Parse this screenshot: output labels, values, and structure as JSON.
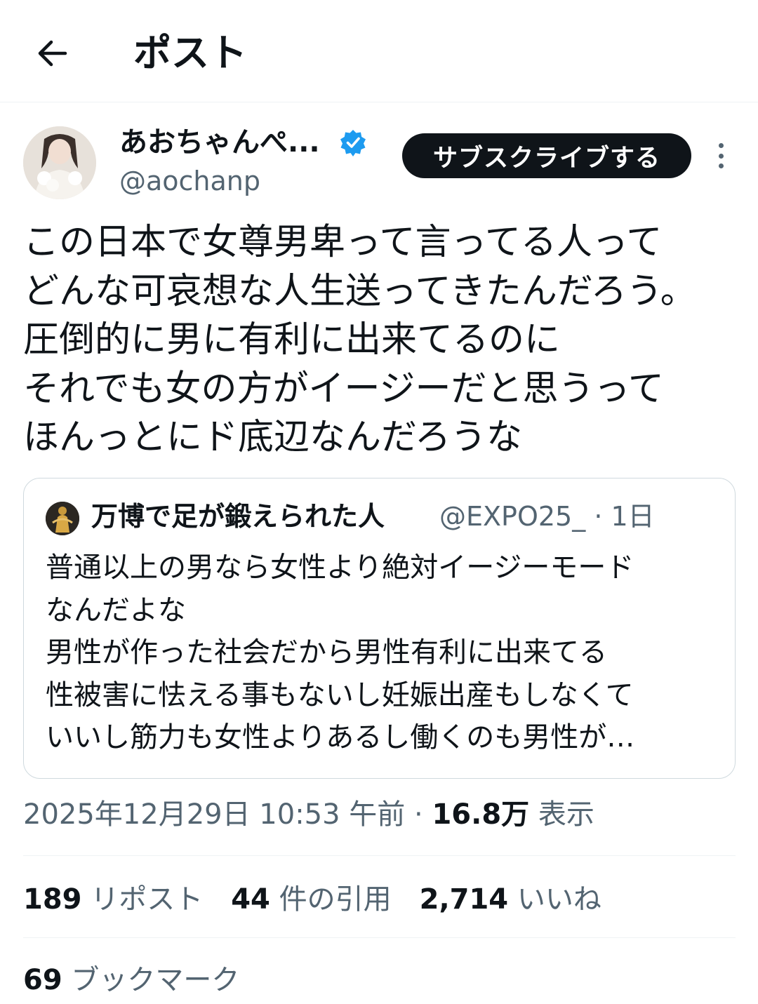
{
  "header": {
    "title": "ポスト",
    "back_icon": "arrow-left-icon"
  },
  "author": {
    "name": "あおちゃんぺ...",
    "handle": "@aochanp",
    "verified_color": "#1d9bf0",
    "subscribe_label": "サブスクライブする",
    "more_icon": "more-vertical-icon"
  },
  "post": {
    "lines": [
      "この日本で女尊男卑って言ってる人って",
      "どんな可哀想な人生送ってきたんだろう。",
      "圧倒的に男に有利に出来てるのに",
      "それでも女の方がイージーだと思うって",
      "ほんっとにド底辺なんだろうな"
    ]
  },
  "quote": {
    "name": "万博で足が鍛えられた人",
    "handle": "@EXPO25_",
    "time": "· 1日",
    "lines": [
      "普通以上の男なら女性より絶対イージーモード",
      "なんだよな",
      "男性が作った社会だから男性有利に出来てる",
      "性被害に怯える事もないし妊娠出産もしなくて",
      "いいし筋力も女性よりあるし働くのも男性が…"
    ]
  },
  "meta": {
    "timestamp": "2025年12月29日 10:53 午前 · ",
    "views_count": "16.8万",
    "views_label": " 表示"
  },
  "stats": {
    "reposts_count": "189",
    "reposts_label": " リポスト",
    "quotes_count": "44",
    "quotes_label": " 件の引用",
    "likes_count": "2,714",
    "likes_label": " いいね",
    "bookmarks_count": "69",
    "bookmarks_label": " ブックマーク"
  }
}
